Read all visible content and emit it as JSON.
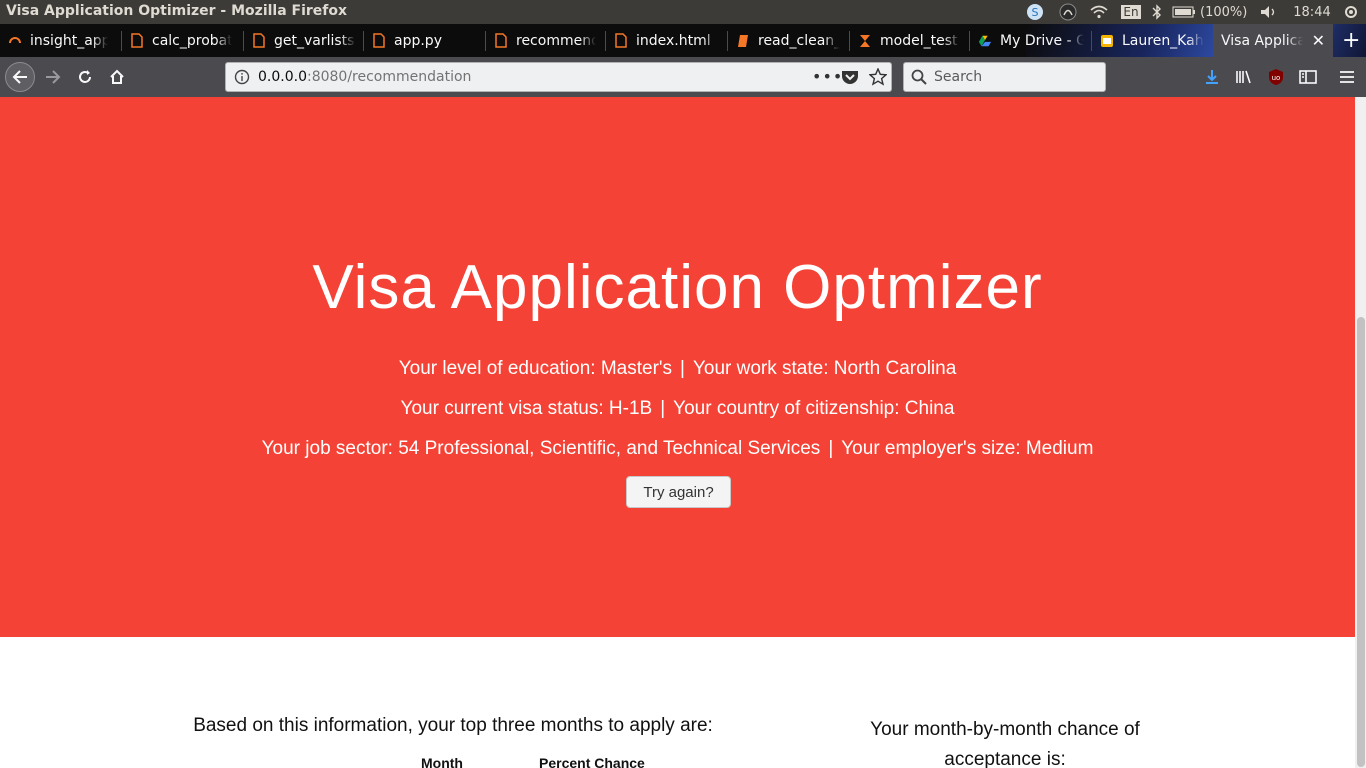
{
  "os": {
    "window_title": "Visa Application Optimizer - Mozilla Firefox",
    "keyboard": "En",
    "battery": "(100%)",
    "time": "18:44"
  },
  "tabs": [
    {
      "label": "insight_app",
      "icon": "insight-icon"
    },
    {
      "label": "calc_probat",
      "icon": "file-icon"
    },
    {
      "label": "get_varlists",
      "icon": "file-icon"
    },
    {
      "label": "app.py",
      "icon": "file-icon"
    },
    {
      "label": "recommenda",
      "icon": "file-icon"
    },
    {
      "label": "index.html",
      "icon": "file-icon"
    },
    {
      "label": "read_clean_",
      "icon": "notebook-icon"
    },
    {
      "label": "model_test",
      "icon": "hourglass-icon"
    },
    {
      "label": "My Drive - G",
      "icon": "drive-icon"
    },
    {
      "label": "Lauren_Kah",
      "icon": "slides-icon"
    },
    {
      "label": "Visa Applica",
      "icon": "none",
      "active": true
    }
  ],
  "navbar": {
    "url_host": "0.0.0.0",
    "url_path": ":8080/recommendation",
    "search_placeholder": "Search"
  },
  "hero": {
    "title": "Visa Application Optmizer",
    "line1_a": "Your level of education: Master's",
    "line1_b": "Your work state: North Carolina",
    "line2_a": "Your current visa status: H-1B",
    "line2_b": "Your country of citizenship: China",
    "line3_a": "Your job sector: 54 Professional, Scientific, and Technical Services",
    "line3_b": "Your employer's size: Medium",
    "separator": "|",
    "try_again": "Try again?"
  },
  "lower": {
    "top_three_heading": "Based on this information, your top three months to apply are:",
    "col_month": "Month",
    "col_percent": "Percent Chance",
    "monthly_heading": "Your month-by-month chance of acceptance is:"
  },
  "colors": {
    "hero_bg": "#f44336",
    "chrome_dark": "#0c0c0d",
    "toolbar": "#4a4a4f"
  }
}
